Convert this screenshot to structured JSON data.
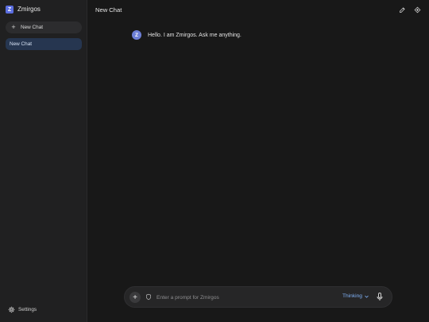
{
  "sidebar": {
    "brand": {
      "logo_letter": "Z",
      "name": "Zmirgos"
    },
    "new_chat_label": "New Chat",
    "history": [
      {
        "label": "New Chat",
        "active": true
      }
    ],
    "settings_label": "Settings"
  },
  "header": {
    "title": "New Chat",
    "actions": [
      {
        "icon": "edit-icon"
      },
      {
        "icon": "brain-icon"
      }
    ]
  },
  "conversation": {
    "messages": [
      {
        "role": "assistant",
        "avatar_letter": "Z",
        "text": "Hello. I am Zmirgos. Ask me anything."
      }
    ]
  },
  "composer": {
    "placeholder": "Enter a prompt for Zmirgos",
    "value": "",
    "mode": "Thinking"
  },
  "colors": {
    "accent": "#7fb0f5",
    "brand": "#5b6ee1",
    "active_item": "#263650",
    "background": "#181818",
    "sidebar": "#202021"
  }
}
